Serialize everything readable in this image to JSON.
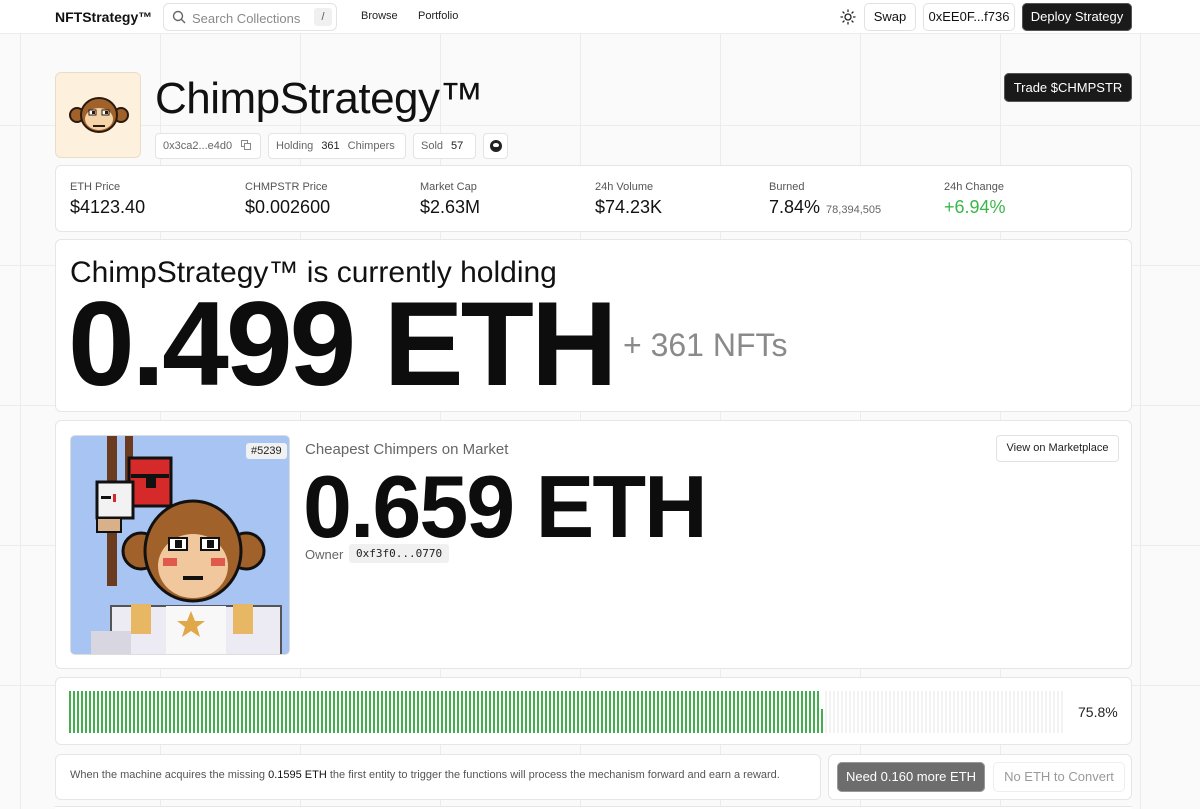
{
  "nav": {
    "brand": "NFTStrategy™",
    "search_placeholder": "Search Collections",
    "search_shortcut": "/",
    "links": [
      "Browse",
      "Portfolio"
    ],
    "theme_icon": "sun-icon",
    "swap_label": "Swap",
    "wallet_label": "0xEE0F...f736",
    "deploy_label": "Deploy Strategy"
  },
  "collection": {
    "title": "ChimpStrategy™",
    "address": "0x3ca2...e4d0",
    "holding_label": "Holding",
    "holding_count": "361",
    "holding_unit": "Chimpers",
    "sold_label": "Sold",
    "sold_count": "57",
    "trade_label": "Trade $CHMPSTR"
  },
  "stats": [
    {
      "label": "ETH Price",
      "value": "$4123.40",
      "sub": ""
    },
    {
      "label": "CHMPSTR Price",
      "value": "$0.002600",
      "sub": ""
    },
    {
      "label": "Market Cap",
      "value": "$2.63M",
      "sub": ""
    },
    {
      "label": "24h Volume",
      "value": "$74.23K",
      "sub": ""
    },
    {
      "label": "Burned",
      "value": "7.84%",
      "sub": "78,394,505"
    },
    {
      "label": "24h Change",
      "value": "+6.94%",
      "sub": ""
    }
  ],
  "holding": {
    "heading": "ChimpStrategy™ is currently holding",
    "amount": "0.499 ETH",
    "nfts": "+ 361 NFTs"
  },
  "market": {
    "token_id": "#5239",
    "label": "Cheapest Chimpers on Market",
    "price": "0.659 ETH",
    "owner_label": "Owner",
    "owner": "0xf3f0...0770",
    "marketplace_label": "View on Marketplace"
  },
  "progress": {
    "fraction": 0.758,
    "label": "75.8%"
  },
  "footer": {
    "text_before": "When the machine acquires the missing",
    "missing_eth": "0.1595 ETH",
    "text_after": "the first entity to trigger the functions will process the mechanism forward and earn a reward.",
    "need_label": "Need 0.160 more ETH",
    "convert_label": "No ETH to Convert"
  },
  "colors": {
    "accent_green": "#3cb64a",
    "progress_green": "#43ae4c",
    "dark_button": "#1a1a1a"
  }
}
